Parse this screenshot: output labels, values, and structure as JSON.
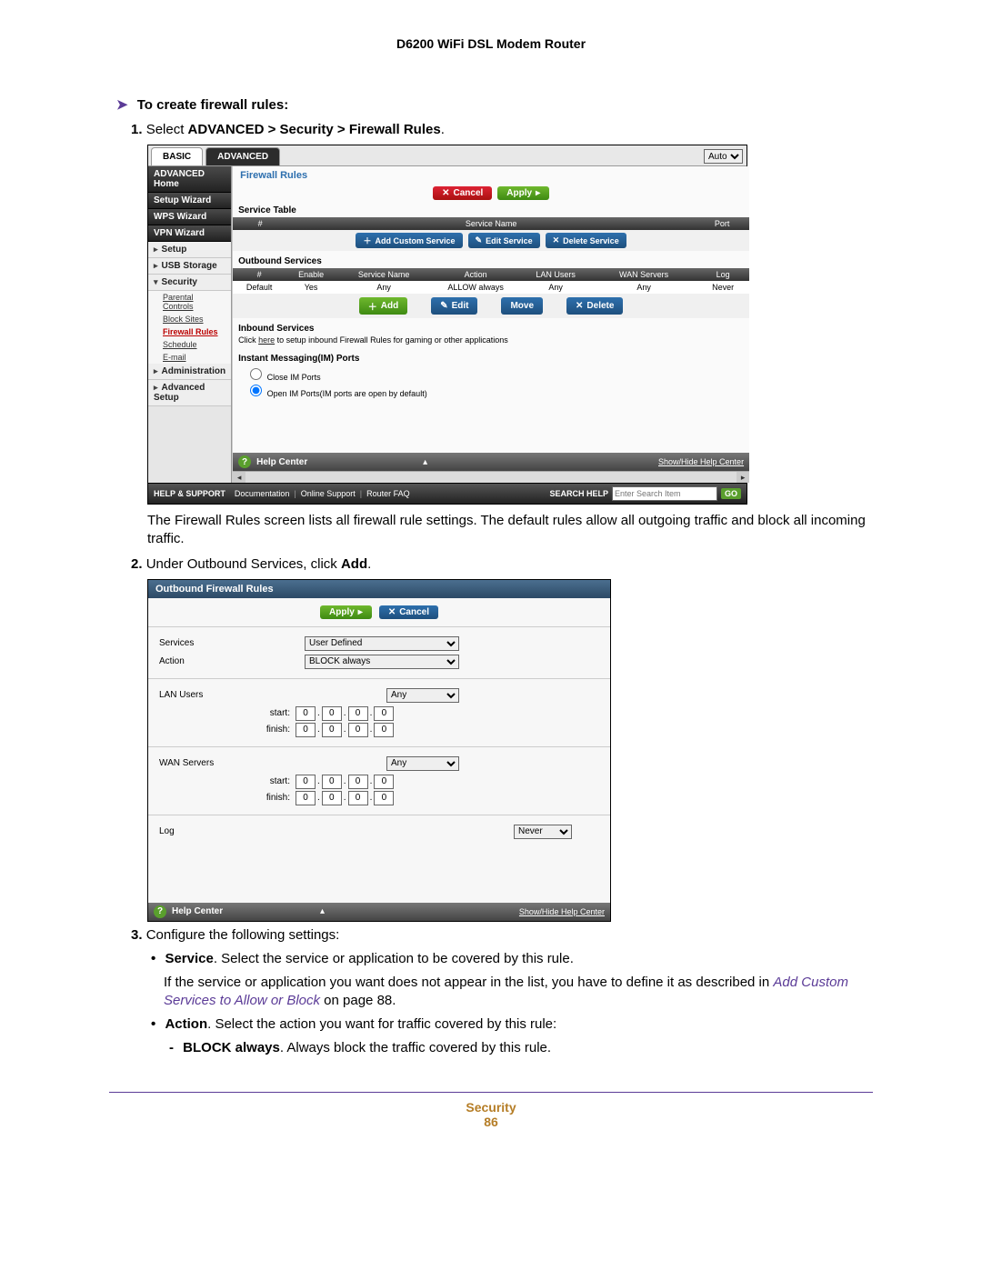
{
  "doc": {
    "header": "D6200 WiFi DSL Modem Router",
    "section_title": "To create firewall rules:",
    "step1_prefix": "1.",
    "step1_a": "Select ",
    "step1_b": "ADVANCED > Security > Firewall Rules",
    "step1_c": ".",
    "desc1": "The Firewall Rules screen lists all firewall rule settings. The default rules allow all outgoing traffic and block all incoming traffic.",
    "step2_prefix": "2.",
    "step2_a": "Under Outbound Services, click ",
    "step2_b": "Add",
    "step2_c": ".",
    "step3_prefix": "3.",
    "step3_text": "Configure the following settings:",
    "bullet1_b": "Service",
    "bullet1_t": ". Select the service or application to be covered by this rule.",
    "bullet1_cont_a": "If the service or application you want does not appear in the list, you have to define it as described in ",
    "bullet1_link": "Add Custom Services to Allow or Block",
    "bullet1_cont_b": " on page 88.",
    "bullet2_b": "Action",
    "bullet2_t": ". Select the action you want for traffic covered by this rule:",
    "sub1_b": "BLOCK always",
    "sub1_t": ". Always block the traffic covered by this rule.",
    "footer_section": "Security",
    "page_number": "86"
  },
  "shot1": {
    "tab_basic": "BASIC",
    "tab_advanced": "ADVANCED",
    "auto": "Auto",
    "sidebar": {
      "adv_home": "ADVANCED Home",
      "setup_wizard": "Setup Wizard",
      "wps_wizard": "WPS Wizard",
      "vpn_wizard": "VPN Wizard",
      "setup": "Setup",
      "usb_storage": "USB Storage",
      "security": "Security",
      "parental": "Parental Controls",
      "block_sites": "Block Sites",
      "firewall_rules": "Firewall Rules",
      "schedule": "Schedule",
      "email": "E-mail",
      "administration": "Administration",
      "adv_setup": "Advanced Setup"
    },
    "main": {
      "title": "Firewall Rules",
      "cancel": "Cancel",
      "apply": "Apply",
      "service_table": "Service Table",
      "h_hash": "#",
      "h_service_name": "Service Name",
      "h_port": "Port",
      "add_custom": "Add Custom Service",
      "edit_service": "Edit Service",
      "delete_service": "Delete Service",
      "outbound": "Outbound Services",
      "h_enable": "Enable",
      "h_action": "Action",
      "h_lan": "LAN Users",
      "h_wan": "WAN Servers",
      "h_log": "Log",
      "row_default": "Default",
      "row_yes": "Yes",
      "row_any": "Any",
      "row_allow": "ALLOW always",
      "row_never": "Never",
      "add": "Add",
      "edit": "Edit",
      "move": "Move",
      "delete": "Delete",
      "inbound": "Inbound Services",
      "inbound_note_a": "Click ",
      "inbound_note_b": "here",
      "inbound_note_c": " to setup inbound Firewall Rules for gaming or other applications",
      "im_heading": "Instant Messaging(IM) Ports",
      "close_im": "Close IM Ports",
      "open_im": "Open IM Ports(IM ports are open by default)",
      "help_center": "Help Center",
      "show_hide": "Show/Hide Help Center",
      "help_support": "HELP & SUPPORT",
      "documentation": "Documentation",
      "online_support": "Online Support",
      "router_faq": "Router FAQ",
      "search_help": "SEARCH HELP",
      "search_placeholder": "Enter Search Item",
      "go": "GO"
    }
  },
  "shot2": {
    "title": "Outbound Firewall Rules",
    "apply": "Apply",
    "cancel": "Cancel",
    "services": "Services",
    "services_val": "User Defined",
    "action": "Action",
    "action_val": "BLOCK always",
    "lan_users": "LAN Users",
    "any": "Any",
    "start": "start:",
    "finish": "finish:",
    "wan_servers": "WAN Servers",
    "log": "Log",
    "never": "Never",
    "zero": "0",
    "help_center": "Help Center",
    "show_hide": "Show/Hide Help Center"
  }
}
